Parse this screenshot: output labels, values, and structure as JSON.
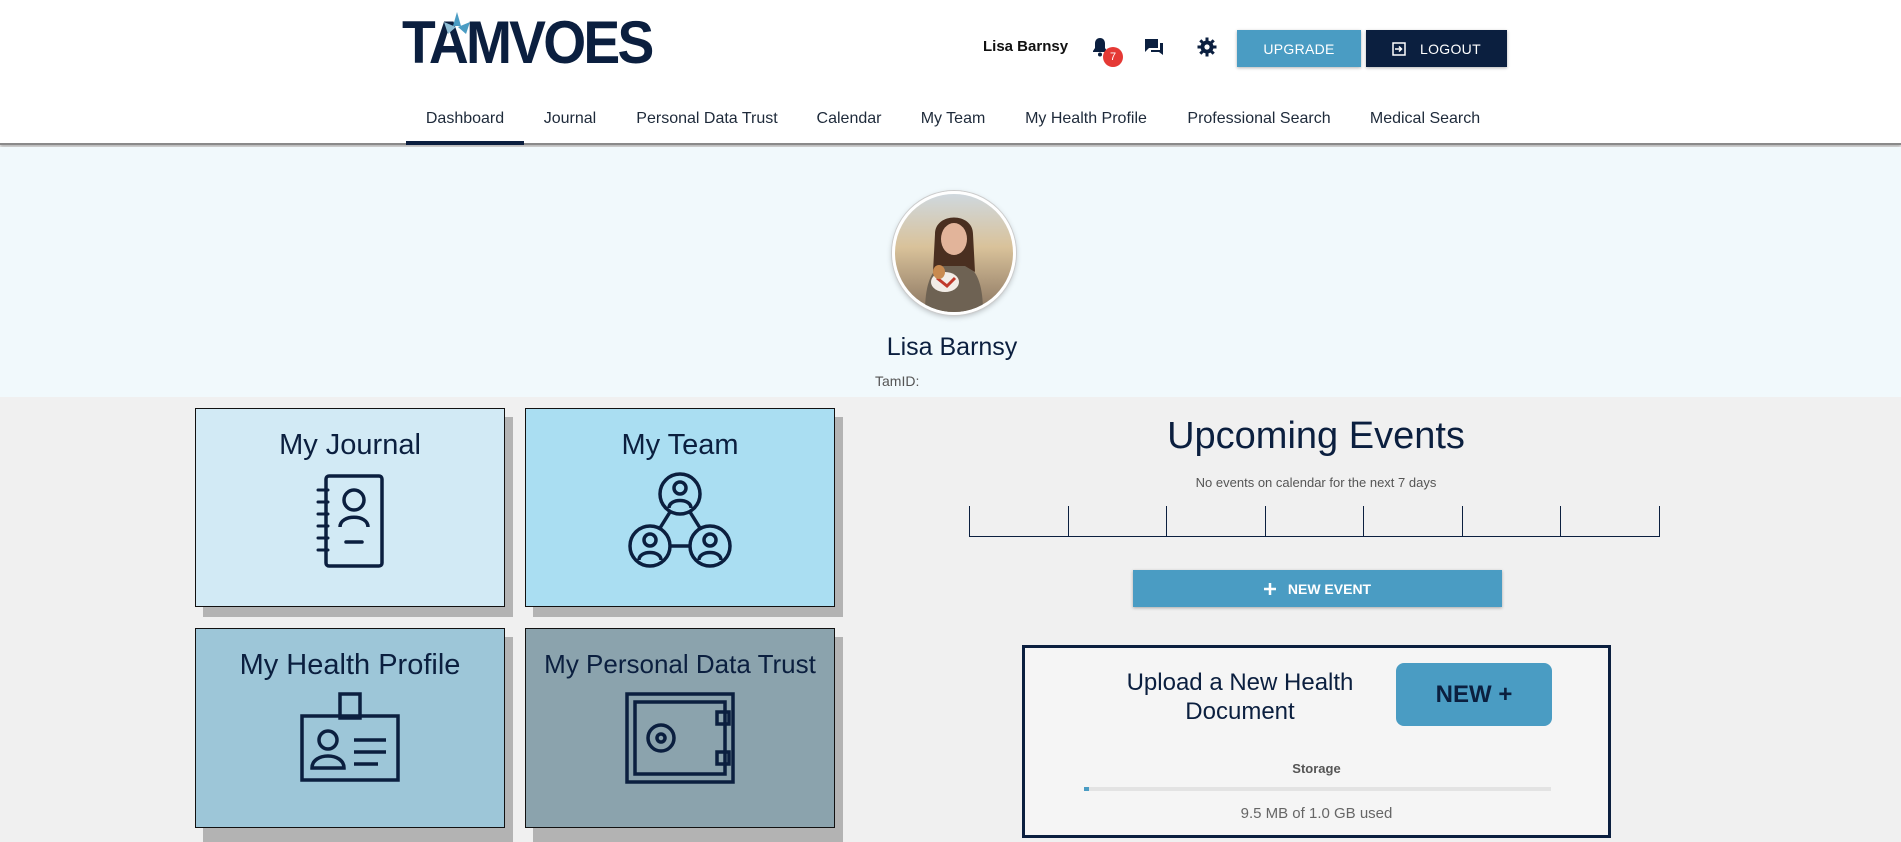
{
  "header": {
    "logo_text": "TAMVOES",
    "user_name": "Lisa Barnsy",
    "notification_count": "7",
    "upgrade_label": "UPGRADE",
    "logout_label": "LOGOUT"
  },
  "nav": {
    "items": [
      {
        "label": "Dashboard",
        "active": true
      },
      {
        "label": "Journal"
      },
      {
        "label": "Personal Data Trust"
      },
      {
        "label": "Calendar"
      },
      {
        "label": "My Team"
      },
      {
        "label": "My Health Profile"
      },
      {
        "label": "Professional Search"
      },
      {
        "label": "Medical Search"
      }
    ]
  },
  "profile": {
    "name": "Lisa Barnsy",
    "tamid_label": "TamID:"
  },
  "tiles": [
    {
      "title": "My Journal",
      "icon": "journal-contact-icon",
      "color": "#d2eaf5"
    },
    {
      "title": "My Team",
      "icon": "team-network-icon",
      "color": "#aadef2"
    },
    {
      "title": "My Health Profile",
      "icon": "id-badge-icon",
      "color": "#9dc6d8"
    },
    {
      "title": "My Personal Data Trust",
      "icon": "safe-vault-icon",
      "color": "#8ba3ad"
    }
  ],
  "events": {
    "title": "Upcoming Events",
    "subtitle": "No events on calendar for the next 7 days",
    "new_event_label": "NEW EVENT"
  },
  "upload": {
    "title": "Upload a New Health Document",
    "new_button_label": "NEW +",
    "storage_label": "Storage",
    "storage_used_text": "9.5 MB of 1.0 GB used",
    "storage_fraction": 0.0095
  },
  "colors": {
    "navy": "#0b1f3f",
    "accent": "#4a9cc3",
    "badge": "#e53935"
  }
}
